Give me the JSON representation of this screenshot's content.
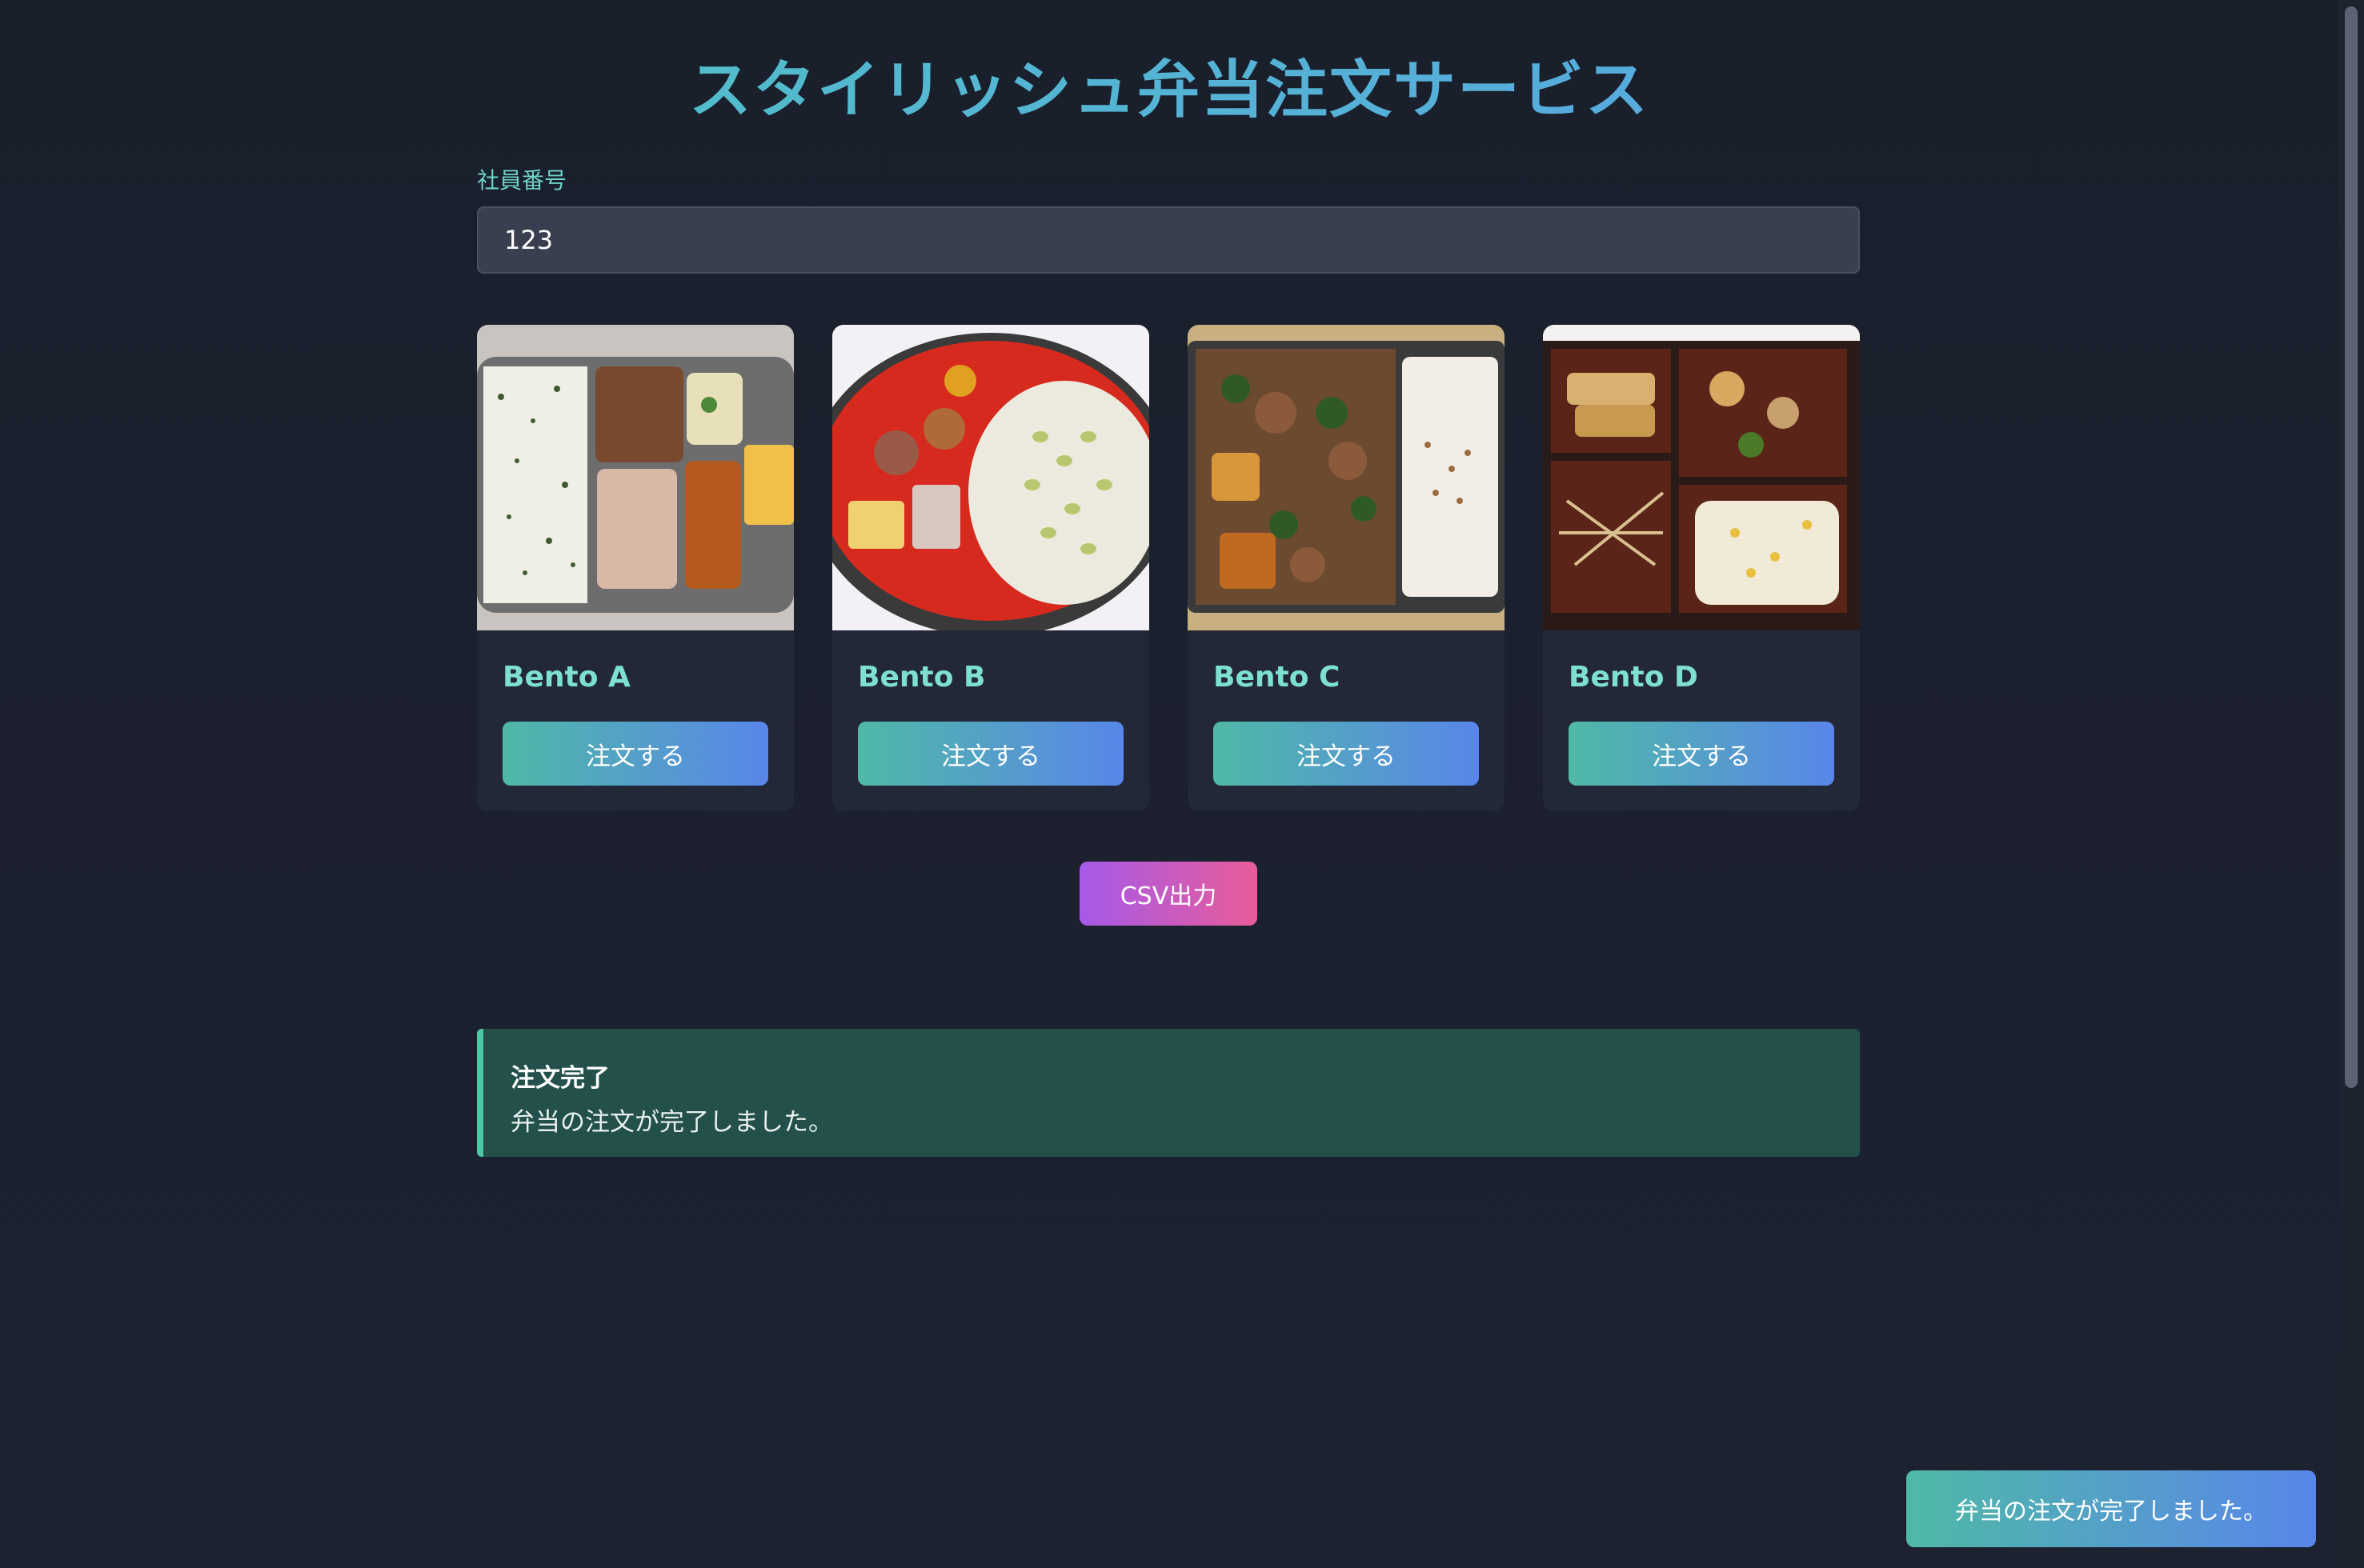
{
  "page": {
    "title": "スタイリッシュ弁当注文サービス"
  },
  "form": {
    "label": "社員番号",
    "value": "123"
  },
  "bentos": [
    {
      "name": "Bento A",
      "button": "注文する"
    },
    {
      "name": "Bento B",
      "button": "注文する"
    },
    {
      "name": "Bento C",
      "button": "注文する"
    },
    {
      "name": "Bento D",
      "button": "注文する"
    }
  ],
  "csv_button": "CSV出力",
  "alert": {
    "title": "注文完了",
    "message": "弁当の注文が完了しました。"
  },
  "toast": {
    "message": "弁当の注文が完了しました。"
  },
  "colors": {
    "accent": "#4fb9a6",
    "accent_end": "#5986ea",
    "csv_start": "#a55ae8",
    "csv_end": "#e85c9a",
    "background": "#1a1f2c"
  }
}
